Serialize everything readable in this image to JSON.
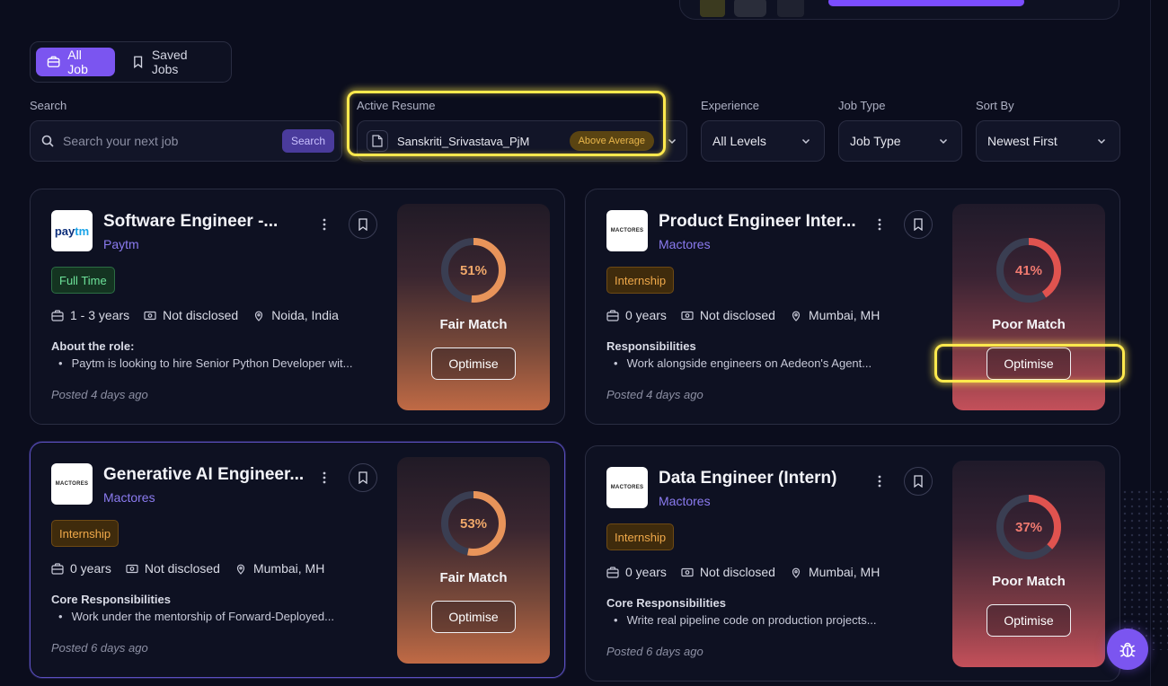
{
  "tabs": [
    {
      "label": "All Job",
      "icon": "briefcase-icon",
      "active": true
    },
    {
      "label": "Saved Jobs",
      "icon": "bookmark-icon",
      "active": false
    }
  ],
  "filters": {
    "search": {
      "label": "Search",
      "placeholder": "Search your next job",
      "button": "Search"
    },
    "resume": {
      "label": "Active Resume",
      "name": "Sanskriti_Srivastava_PjM",
      "badge": "Above Average"
    },
    "experience": {
      "label": "Experience",
      "value": "All Levels"
    },
    "job_type": {
      "label": "Job Type",
      "value": "Job Type"
    },
    "sort": {
      "label": "Sort By",
      "value": "Newest First"
    }
  },
  "colors": {
    "accent": "#7b55f0",
    "fair": "#e8945a",
    "poor": "#e0534f",
    "company": "#8b7bf0"
  },
  "jobs": [
    {
      "title": "Software Engineer -...",
      "company": "Paytm",
      "logo": "paytm",
      "type": "Full Time",
      "experience": "1 - 3 years",
      "salary": "Not disclosed",
      "location": "Noida, India",
      "section": "About the role:",
      "bullet": "Paytm is looking to hire Senior Python Developer wit...",
      "posted": "Posted 4 days ago",
      "match_pct": "51%",
      "match_value": 51,
      "match_label": "Fair Match",
      "optimise": "Optimise"
    },
    {
      "title": "Product Engineer Inter...",
      "company": "Mactores",
      "logo": "MACTORES",
      "type": "Internship",
      "experience": "0 years",
      "salary": "Not disclosed",
      "location": "Mumbai, MH",
      "section": "Responsibilities",
      "bullet": "Work alongside engineers on Aedeon's Agent...",
      "posted": "Posted 4 days ago",
      "match_pct": "41%",
      "match_value": 41,
      "match_label": "Poor Match",
      "optimise": "Optimise"
    },
    {
      "title": "Generative AI Engineer...",
      "company": "Mactores",
      "logo": "MACTORES",
      "type": "Internship",
      "experience": "0 years",
      "salary": "Not disclosed",
      "location": "Mumbai, MH",
      "section": "Core Responsibilities",
      "bullet": "Work under the mentorship of Forward-Deployed...",
      "posted": "Posted 6 days ago",
      "match_pct": "53%",
      "match_value": 53,
      "match_label": "Fair Match",
      "optimise": "Optimise"
    },
    {
      "title": "Data Engineer (Intern)",
      "company": "Mactores",
      "logo": "MACTORES",
      "type": "Internship",
      "experience": "0 years",
      "salary": "Not disclosed",
      "location": "Mumbai, MH",
      "section": "Core Responsibilities",
      "bullet": "Write real pipeline code on production projects...",
      "posted": "Posted 6 days ago",
      "match_pct": "37%",
      "match_value": 37,
      "match_label": "Poor Match",
      "optimise": "Optimise"
    }
  ],
  "fab_icon": "bug-icon"
}
